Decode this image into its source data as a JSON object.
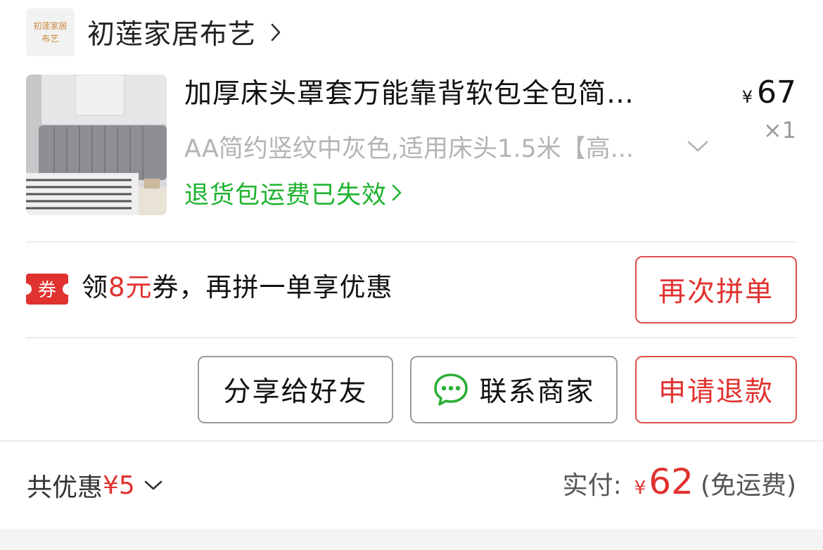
{
  "shop": {
    "logo_line1": "初莲家居",
    "logo_line2": "布艺",
    "name": "初莲家居布艺"
  },
  "product": {
    "title": "加厚床头罩套万能靠背软包全包简…",
    "price_symbol": "¥",
    "price": "67",
    "quantity": "×1",
    "spec": "AA简约竖纹中灰色,适用床头1.5米【高...",
    "return_note": "退货包运费已失效"
  },
  "coupon": {
    "badge": "券",
    "text_before": "领",
    "amount": "8元",
    "text_after": "券，再拼一单享优惠",
    "reorder_button": "再次拼单"
  },
  "actions": {
    "share_button": "分享给好友",
    "contact_button": "联系商家",
    "refund_button": "申请退款"
  },
  "summary": {
    "discount_label": "共优惠",
    "discount_amount": "¥5",
    "paid_label": "实付:",
    "paid_symbol": "¥",
    "paid_amount": "62",
    "shipping_note": "(免运费)"
  },
  "colors": {
    "accent_red": "#e0322f",
    "success_green": "#1fb32f",
    "wechat_green": "#2aae33"
  },
  "icons": [
    "chevron-right-icon",
    "chevron-down-icon",
    "coupon-badge-icon",
    "chat-bubble-icon"
  ]
}
